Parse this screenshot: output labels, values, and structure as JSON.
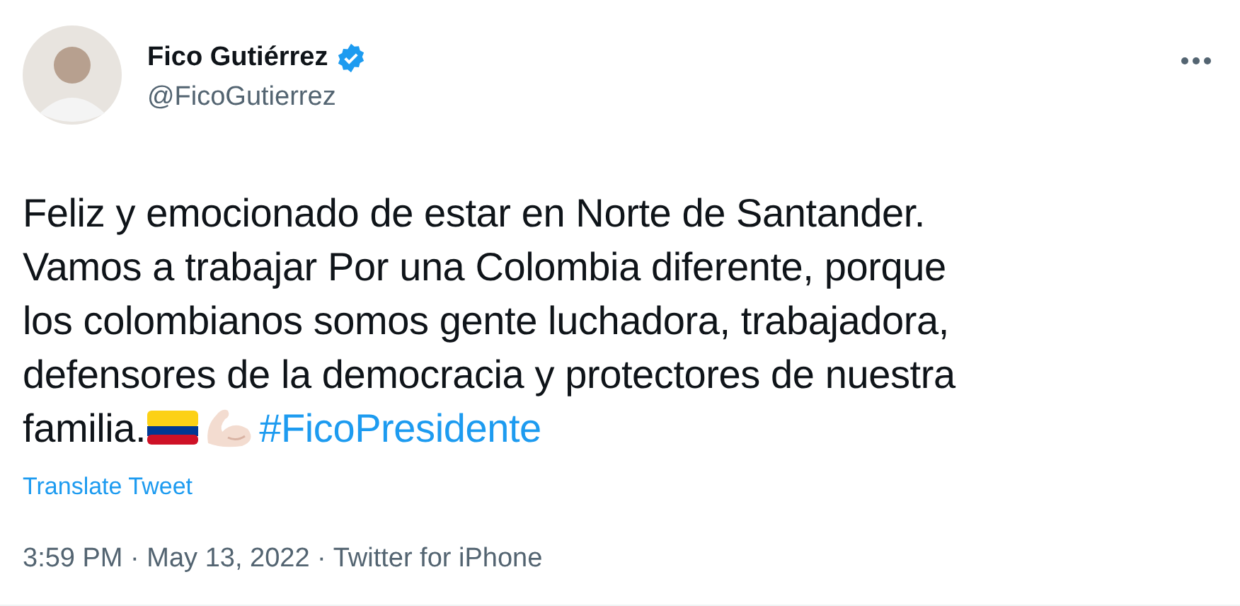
{
  "author": {
    "name": "Fico Gutiérrez",
    "verified": true,
    "handle": "@FicoGutierrez"
  },
  "tweet": {
    "lines": [
      "Feliz y emocionado de estar en Norte de Santander.",
      "Vamos a trabajar Por una Colombia diferente, porque",
      "los colombianos somos gente luchadora, trabajadora,",
      "defensores de la democracia y protectores de nuestra"
    ],
    "last_line": "familia.",
    "hashtag": "#FicoPresidente"
  },
  "translate_link": "Translate Tweet",
  "meta": [
    "3:59 PM",
    "May 13, 2022",
    "Twitter for iPhone"
  ],
  "separator": "·"
}
